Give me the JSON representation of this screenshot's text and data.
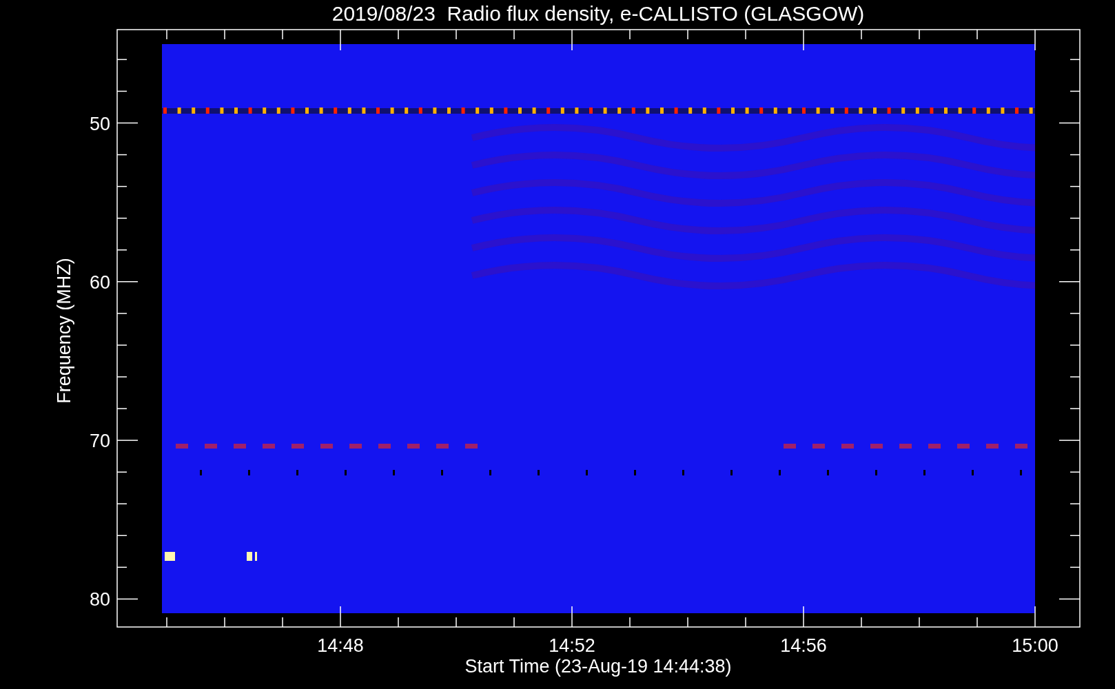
{
  "title": "2019/08/23  Radio flux density, e-CALLISTO (GLASGOW)",
  "y_axis": {
    "label": "Frequency (MHZ)",
    "ticks": [
      "50",
      "60",
      "70",
      "80"
    ]
  },
  "x_axis": {
    "label": "Start Time (23-Aug-19 14:44:38)",
    "ticks": [
      "14:48",
      "14:52",
      "14:56",
      "15:00"
    ]
  }
}
